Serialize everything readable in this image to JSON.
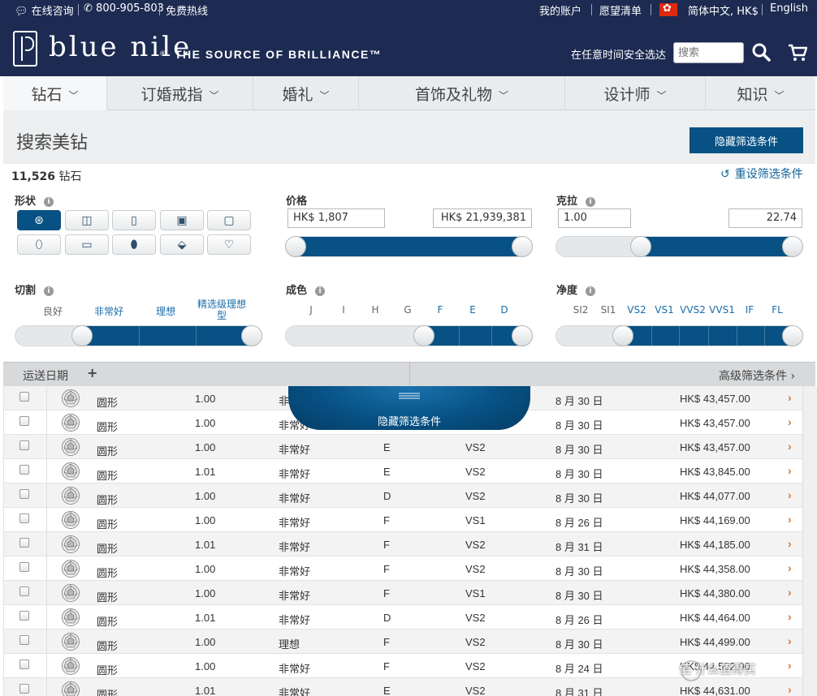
{
  "topbar": {
    "chat_label": "在线咨询",
    "phone": "800-905-803",
    "hotline": "免费热线",
    "account": "我的账户",
    "wishlist": "愿望清单",
    "locale": "简体中文, HK$",
    "english": "English"
  },
  "header": {
    "logo_text": "blue nile",
    "logo_reg": "®",
    "tagline": "THE SOURCE OF BRILLIANCE™",
    "secure_shopping": "在任意时间安全选达",
    "search_placeholder": "搜索"
  },
  "nav": {
    "items": [
      {
        "label": "钻石"
      },
      {
        "label": "订婚戒指"
      },
      {
        "label": "婚礼"
      },
      {
        "label": "首饰及礼物"
      },
      {
        "label": "设计师"
      },
      {
        "label": "知识"
      }
    ]
  },
  "filters": {
    "page_title": "搜索美钻",
    "hide_button": "隐藏筛选条件",
    "result_count": "11,526",
    "result_unit": "钻石",
    "reset_label": "重设筛选条件",
    "shape_label": "形状",
    "price_label": "价格",
    "price_min": "HK$ 1,807",
    "price_max": "HK$ 21,939,381",
    "carat_label": "克拉",
    "carat_min": "1.00",
    "carat_max": "22.74",
    "cut_label": "切割",
    "cut_grades": [
      "良好",
      "非常好",
      "理想",
      "精选级理想型"
    ],
    "color_label": "成色",
    "color_grades": [
      "J",
      "I",
      "H",
      "G",
      "F",
      "E",
      "D"
    ],
    "clarity_label": "净度",
    "clarity_grades": [
      "SI2",
      "SI1",
      "VS2",
      "VS1",
      "VVS2",
      "VVS1",
      "IF",
      "FL"
    ],
    "shipping_label": "运送日期",
    "shipping_plus": "+",
    "advanced_label": "高级筛选条件",
    "advanced_chevron": "›",
    "float_tab_label": "隐藏筛选条件"
  },
  "results": {
    "rows": [
      {
        "shape": "圆形",
        "carat": "1.00",
        "cut": "非",
        "color": "",
        "clarity": "",
        "date": "8 月 30 日",
        "price": "HK$ 43,457.00"
      },
      {
        "shape": "圆形",
        "carat": "1.00",
        "cut": "非常好",
        "color": "",
        "clarity": "",
        "date": "8 月 30 日",
        "price": "HK$ 43,457.00"
      },
      {
        "shape": "圆形",
        "carat": "1.00",
        "cut": "非常好",
        "color": "E",
        "clarity": "VS2",
        "date": "8 月 30 日",
        "price": "HK$ 43,457.00"
      },
      {
        "shape": "圆形",
        "carat": "1.01",
        "cut": "非常好",
        "color": "E",
        "clarity": "VS2",
        "date": "8 月 30 日",
        "price": "HK$ 43,845.00"
      },
      {
        "shape": "圆形",
        "carat": "1.00",
        "cut": "非常好",
        "color": "D",
        "clarity": "VS2",
        "date": "8 月 30 日",
        "price": "HK$ 44,077.00"
      },
      {
        "shape": "圆形",
        "carat": "1.00",
        "cut": "非常好",
        "color": "F",
        "clarity": "VS1",
        "date": "8 月 26 日",
        "price": "HK$ 44,169.00"
      },
      {
        "shape": "圆形",
        "carat": "1.01",
        "cut": "非常好",
        "color": "F",
        "clarity": "VS2",
        "date": "8 月 31 日",
        "price": "HK$ 44,185.00"
      },
      {
        "shape": "圆形",
        "carat": "1.00",
        "cut": "非常好",
        "color": "F",
        "clarity": "VS2",
        "date": "8 月 30 日",
        "price": "HK$ 44,358.00"
      },
      {
        "shape": "圆形",
        "carat": "1.00",
        "cut": "非常好",
        "color": "F",
        "clarity": "VS1",
        "date": "8 月 30 日",
        "price": "HK$ 44,380.00"
      },
      {
        "shape": "圆形",
        "carat": "1.01",
        "cut": "非常好",
        "color": "D",
        "clarity": "VS2",
        "date": "8 月 26 日",
        "price": "HK$ 44,464.00"
      },
      {
        "shape": "圆形",
        "carat": "1.00",
        "cut": "理想",
        "color": "F",
        "clarity": "VS2",
        "date": "8 月 30 日",
        "price": "HK$ 44,499.00"
      },
      {
        "shape": "圆形",
        "carat": "1.00",
        "cut": "非常好",
        "color": "F",
        "clarity": "VS2",
        "date": "8 月 24 日",
        "price": "HK$ 44,502.00"
      },
      {
        "shape": "圆形",
        "carat": "1.01",
        "cut": "非常好",
        "color": "E",
        "clarity": "VS2",
        "date": "8 月 31 日",
        "price": "HK$ 44,631.00"
      }
    ],
    "row_chevron": "›"
  },
  "watermark": "值 什么值得买",
  "colors": {
    "brand_navy": "#1d2b52",
    "accent_blue": "#075184",
    "link_blue": "#14639a",
    "chevron_orange": "#e0752d"
  }
}
